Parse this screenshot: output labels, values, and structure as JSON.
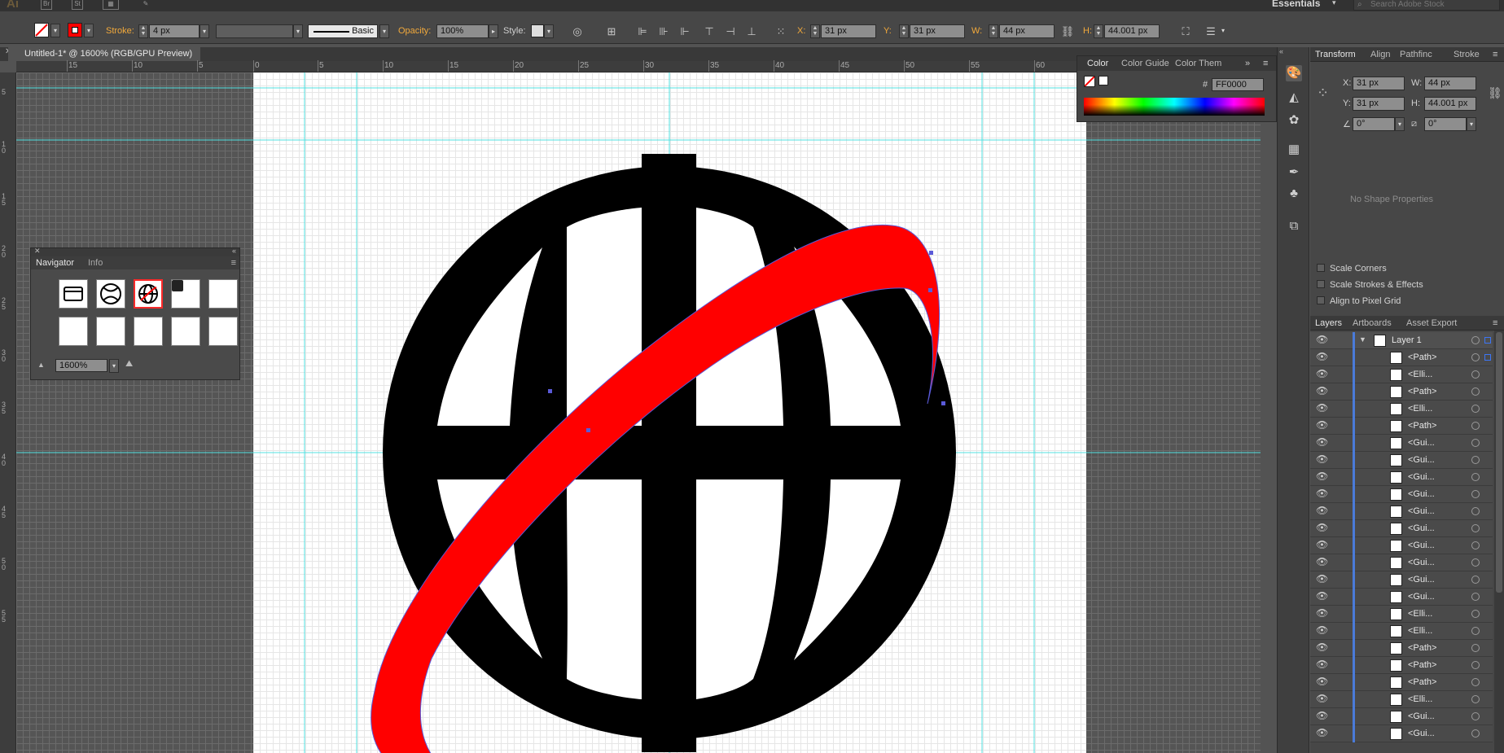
{
  "app": {
    "logo": "Ai",
    "bridge": "Br",
    "stock": "St",
    "workspace": "Essentials",
    "search_placeholder": "Search Adobe Stock"
  },
  "control_bar": {
    "stroke_label": "Stroke:",
    "stroke_value": "4 px",
    "profile_label": "Basic",
    "opacity_label": "Opacity:",
    "opacity_value": "100%",
    "style_label": "Style:",
    "x_label": "X:",
    "x_value": "31 px",
    "y_label": "Y:",
    "y_value": "31 px",
    "w_label": "W:",
    "w_value": "44 px",
    "h_label": "H:",
    "h_value": "44.001 px"
  },
  "document": {
    "tab_title": "Untitled-1* @ 1600% (RGB/GPU Preview)"
  },
  "rulers": {
    "h_labels": [
      "15",
      "10",
      "5",
      "0",
      "5",
      "10",
      "15",
      "20",
      "25",
      "30",
      "35",
      "40",
      "45",
      "50",
      "55",
      "60"
    ],
    "v_labels": [
      "5",
      "10",
      "15",
      "20",
      "25",
      "30",
      "35",
      "40",
      "45",
      "50",
      "55"
    ]
  },
  "navigator": {
    "tab_navigator": "Navigator",
    "tab_info": "Info",
    "zoom": "1600%"
  },
  "color_panel": {
    "tab_color": "Color",
    "tab_guide": "Color Guide",
    "tab_themes": "Color Them",
    "hash": "#",
    "hex": "FF0000"
  },
  "transform": {
    "tab_transform": "Transform",
    "tab_align": "Align",
    "tab_pathfinder": "Pathfinc",
    "tab_stroke": "Stroke",
    "x_label": "X:",
    "x_value": "31 px",
    "y_label": "Y:",
    "y_value": "31 px",
    "w_label": "W:",
    "w_value": "44 px",
    "h_label": "H:",
    "h_value": "44.001 px",
    "angle_value": "0°",
    "shear_value": "0°",
    "no_shape": "No Shape Properties",
    "scale_corners": "Scale Corners",
    "scale_strokes": "Scale Strokes & Effects",
    "align_pixel": "Align to Pixel Grid"
  },
  "layers": {
    "tab_layers": "Layers",
    "tab_artboards": "Artboards",
    "tab_asset": "Asset Export",
    "layer_name": "Layer 1",
    "items": [
      "<Path>",
      "<Elli...",
      "<Path>",
      "<Elli...",
      "<Path>",
      "<Gui...",
      "<Gui...",
      "<Gui...",
      "<Gui...",
      "<Gui...",
      "<Gui...",
      "<Gui...",
      "<Gui...",
      "<Gui...",
      "<Gui...",
      "<Elli...",
      "<Elli...",
      "<Path>",
      "<Path>",
      "<Path>",
      "<Elli...",
      "<Gui...",
      "<Gui..."
    ]
  },
  "colors": {
    "accent_orange": "#f2a93b",
    "selection_blue": "#4a7bd9",
    "guide_cyan": "#50e0e0",
    "fill_red": "#ff0000",
    "globe_black": "#000000"
  }
}
